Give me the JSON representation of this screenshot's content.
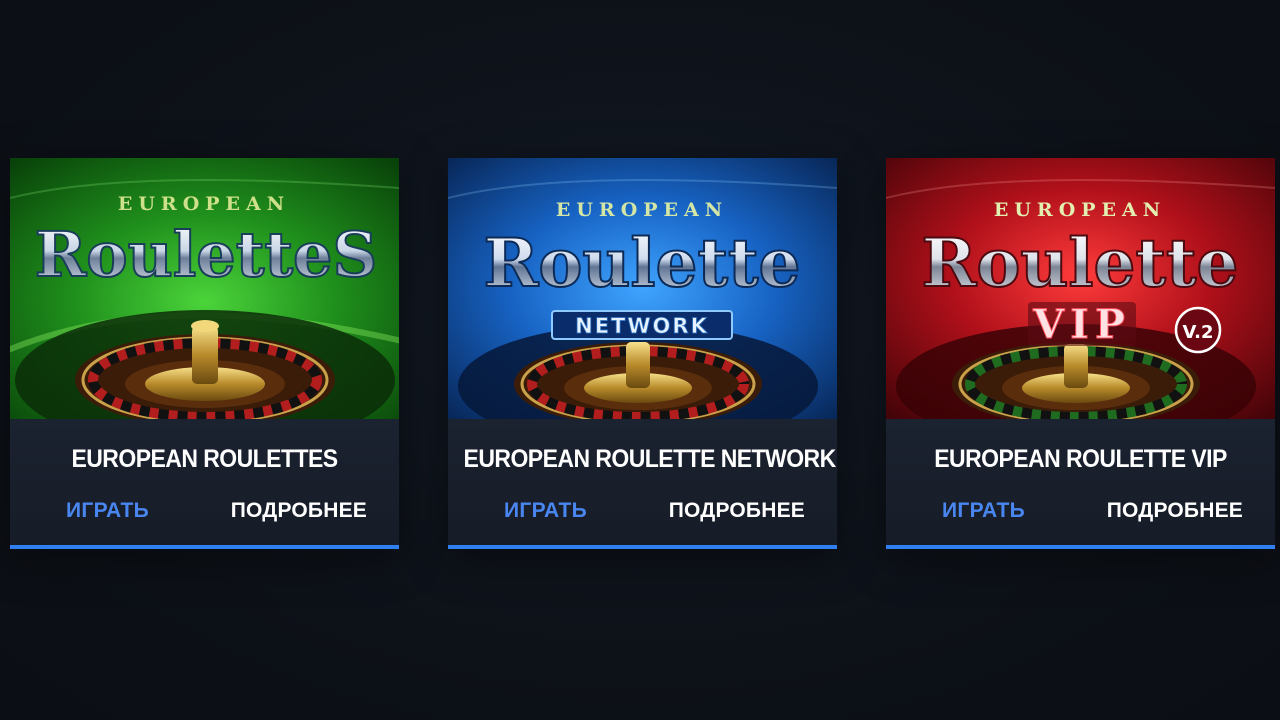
{
  "colors": {
    "accent": "#2f7ff0",
    "play_link": "#4a86f0",
    "page_bg": "#0e121a",
    "card_bg": "#181e2a"
  },
  "games": [
    {
      "title": "EUROPEAN ROULETTES",
      "logo_top": "EUROPEAN",
      "logo_main": "RouletteS",
      "logo_sub": "",
      "theme": "green",
      "play_label": "ИГРАТЬ",
      "more_label": "ПОДРОБНЕЕ"
    },
    {
      "title": "EUROPEAN ROULETTE NETWORK",
      "logo_top": "EUROPEAN",
      "logo_main": "Roulette",
      "logo_sub": "NETWORK",
      "theme": "blue",
      "play_label": "ИГРАТЬ",
      "more_label": "ПОДРОБНЕЕ"
    },
    {
      "title": "EUROPEAN ROULETTE VIP",
      "logo_top": "EUROPEAN",
      "logo_main": "Roulette",
      "logo_sub": "VIP",
      "logo_badge": "V.2",
      "theme": "red",
      "play_label": "ИГРАТЬ",
      "more_label": "ПОДРОБНЕЕ"
    }
  ]
}
